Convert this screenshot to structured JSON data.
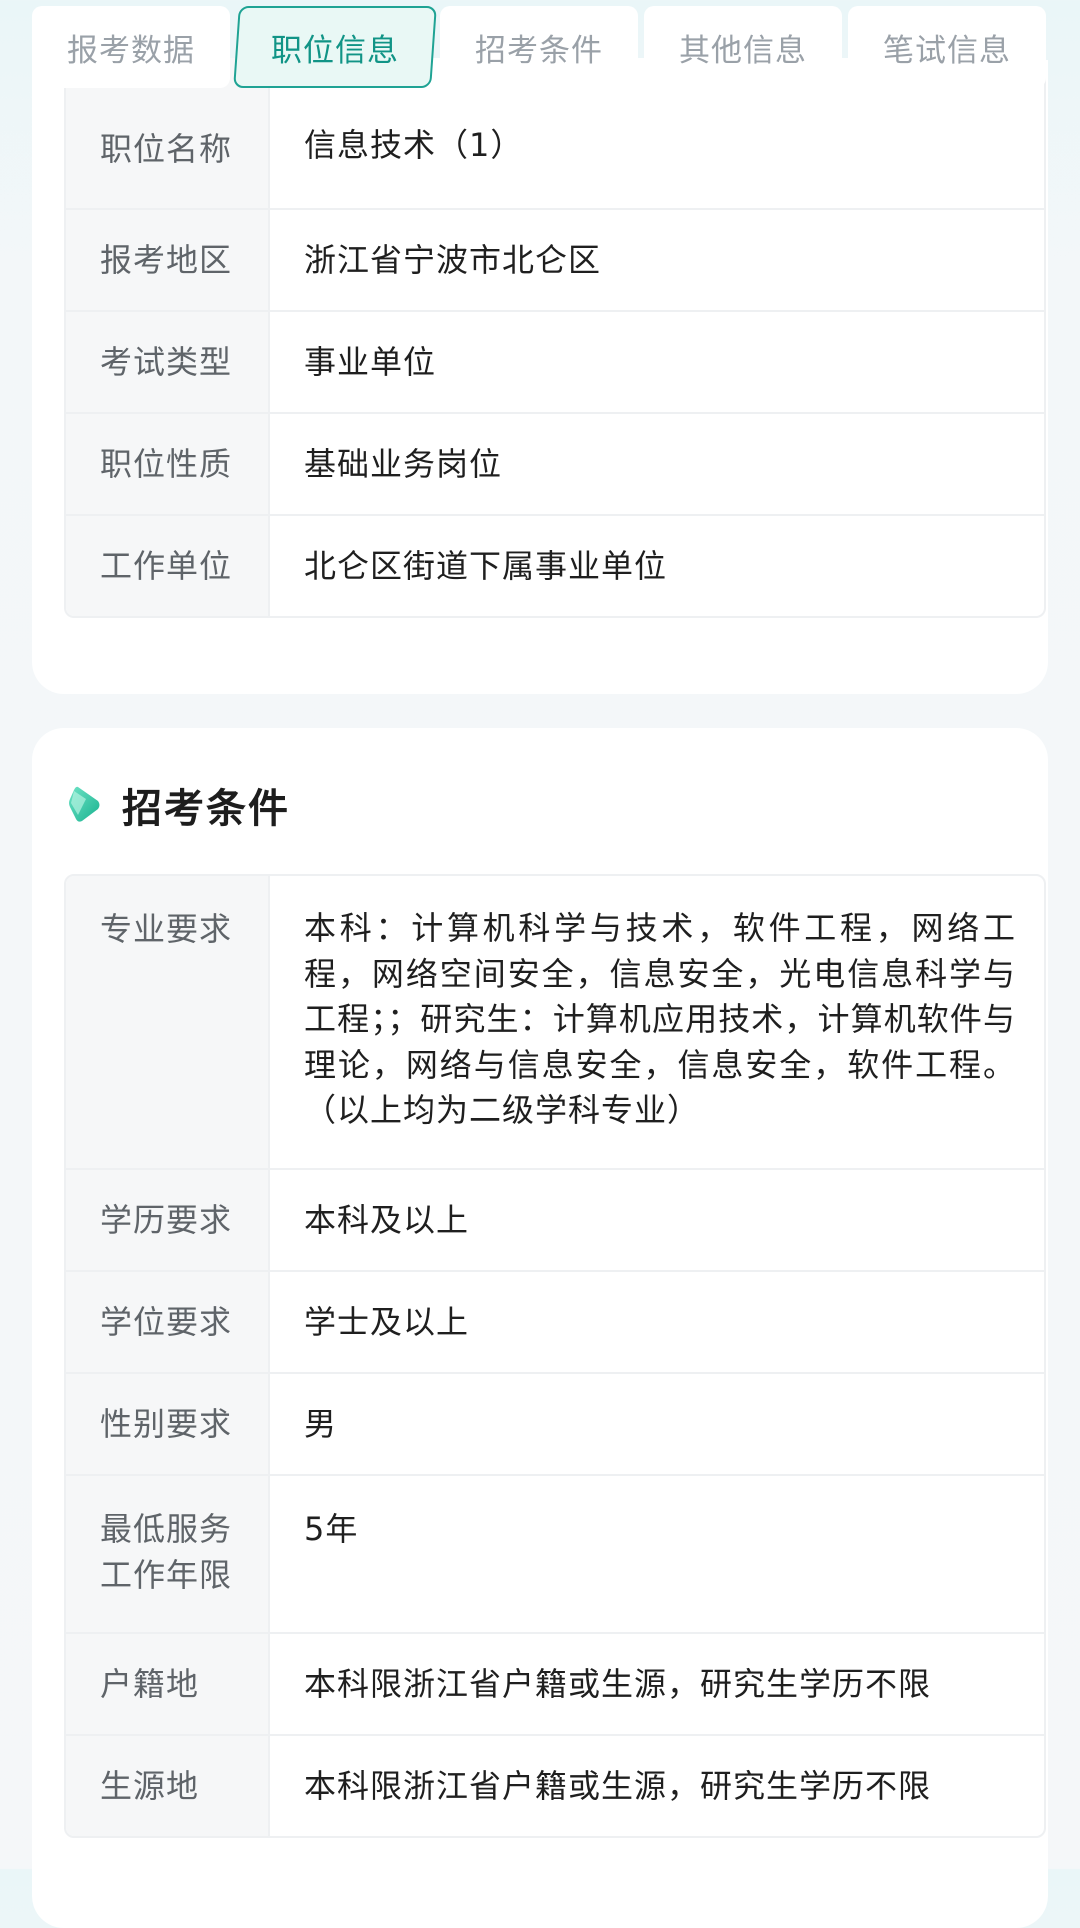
{
  "tabs": [
    {
      "label": "报考数据",
      "active": false
    },
    {
      "label": "职位信息",
      "active": true
    },
    {
      "label": "招考条件",
      "active": false
    },
    {
      "label": "其他信息",
      "active": false
    },
    {
      "label": "笔试信息",
      "active": false
    }
  ],
  "position_info": {
    "rows": [
      {
        "label": "职位名称",
        "value": "信息技术（1）"
      },
      {
        "label": "报考地区",
        "value": "浙江省宁波市北仑区"
      },
      {
        "label": "考试类型",
        "value": "事业单位"
      },
      {
        "label": "职位性质",
        "value": "基础业务岗位"
      },
      {
        "label": "工作单位",
        "value": "北仑区街道下属事业单位"
      }
    ]
  },
  "requirements": {
    "title": "招考条件",
    "rows": [
      {
        "label": "专业要求",
        "value": "本科：计算机科学与技术，软件工程，网络工程，网络空间安全，信息安全，光电信息科学与工程；；研究生：计算机应用技术，计算机软件与理论，网络与信息安全，信息安全，软件工程。（以上均为二级学科专业）"
      },
      {
        "label": "学历要求",
        "value": "本科及以上"
      },
      {
        "label": "学位要求",
        "value": "学士及以上"
      },
      {
        "label": "性别要求",
        "value": "男"
      },
      {
        "label": "最低服务工作年限",
        "value": "5年"
      },
      {
        "label": "户籍地",
        "value": "本科限浙江省户籍或生源，研究生学历不限"
      },
      {
        "label": "生源地",
        "value": "本科限浙江省户籍或生源，研究生学历不限"
      }
    ]
  },
  "colors": {
    "accent": "#1fa394",
    "accent_text": "#119486",
    "label_bg": "#f6f7f8",
    "border": "#eef0f2"
  }
}
